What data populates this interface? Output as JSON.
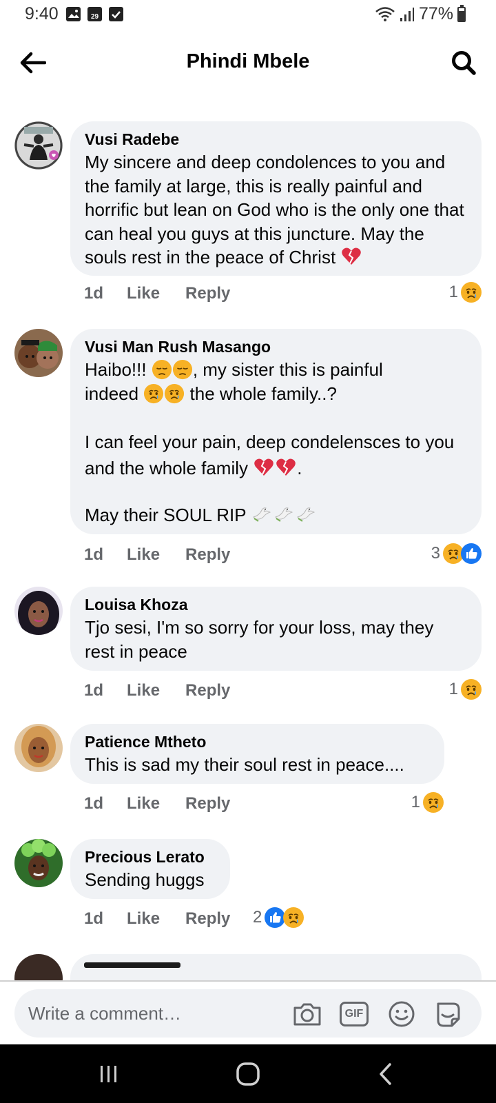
{
  "status": {
    "time": "9:40",
    "calendar_day": "29",
    "battery": "77%"
  },
  "header": {
    "title": "Phindi Mbele"
  },
  "comments": [
    {
      "author": "Vusi Radebe",
      "avatar_text": "I GOT MY COVID-19 VACCINE",
      "text": "My sincere and deep condolences to you and the family at large, this is really painful and horrific but lean on God who is the only one that can heal you guys at this juncture. May the souls rest in the peace of Christ",
      "emoji_trail": [
        "broken-heart"
      ],
      "age": "1d",
      "like_label": "Like",
      "reply_label": "Reply",
      "reaction_count": "1",
      "reactions": [
        "sad"
      ]
    },
    {
      "author": "Vusi Man Rush Masango",
      "line1": "Haibo!!! ",
      "line1_emojis": [
        "disappointed",
        "disappointed"
      ],
      "line1_tail": ", my sister this is painful",
      "line2_head": "indeed ",
      "line2_emojis": [
        "sad",
        "sad"
      ],
      "line2_tail": " the whole family..?",
      "para2": "I can feel your pain, deep condelensces to you and the whole family",
      "para2_emojis": [
        "broken-heart",
        "broken-heart"
      ],
      "para2_tail": ".",
      "para3": "May their SOUL RIP ",
      "para3_emojis": [
        "dove",
        "dove",
        "dove"
      ],
      "age": "1d",
      "like_label": "Like",
      "reply_label": "Reply",
      "reaction_count": "3",
      "reactions": [
        "sad",
        "like"
      ]
    },
    {
      "author": "Louisa Khoza",
      "text": "Tjo sesi, I'm so sorry for your loss, may they rest in peace",
      "age": "1d",
      "like_label": "Like",
      "reply_label": "Reply",
      "reaction_count": "1",
      "reactions": [
        "sad"
      ]
    },
    {
      "author": "Patience Mtheto",
      "text": "This is sad my their soul rest in peace....",
      "age": "1d",
      "like_label": "Like",
      "reply_label": "Reply",
      "reaction_count": "1",
      "reactions": [
        "sad"
      ]
    },
    {
      "author": "Precious Lerato",
      "text": "Sending huggs",
      "age": "1d",
      "like_label": "Like",
      "reply_label": "Reply",
      "reaction_count": "2",
      "reactions": [
        "like",
        "sad"
      ]
    }
  ],
  "composer": {
    "placeholder": "Write a comment…",
    "gif_label": "GIF"
  },
  "icons": {
    "back": "arrow-left-icon",
    "search": "search-icon",
    "camera": "camera-icon",
    "gif": "gif-icon",
    "emoji": "smiley-icon",
    "sticker": "sticker-icon",
    "nav_recent": "recent-apps-icon",
    "nav_home": "home-icon",
    "nav_back": "nav-back-icon"
  },
  "colors": {
    "bubble": "#f0f2f5",
    "like_blue": "#1877f2",
    "sad_yellow": "#f7b125",
    "heart_red": "#dd2e44"
  }
}
